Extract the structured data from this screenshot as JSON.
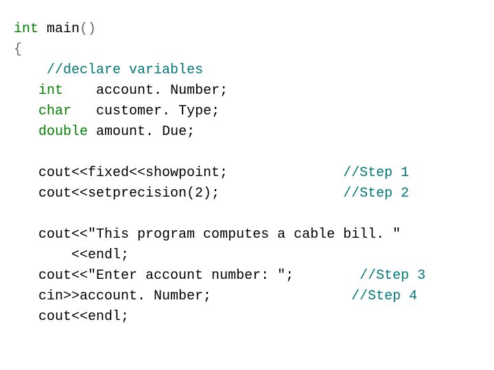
{
  "code": {
    "kw_int1": "int",
    "main": " main",
    "paren": "()",
    "brace_open": "{",
    "indent1": "    ",
    "cm_declare": "//declare variables",
    "indent2": "   ",
    "kw_int2": "int",
    "spc_int2": "    ",
    "var_account": "account. Number;",
    "kw_char": "char",
    "spc_char": "   ",
    "var_cust": "customer. Type;",
    "kw_double": "double",
    "spc_double": " ",
    "var_amount": "amount. Due;",
    "blank": "",
    "cout1a": "cout<<fixed<<showpoint;",
    "gap1": "              ",
    "cm_step1": "//Step 1",
    "cout2a": "cout<<setprecision(2);",
    "gap2": "               ",
    "cm_step2": "//Step 2",
    "cout3a": "cout<<",
    "str3": "\"This program computes a cable bill. \"",
    "cout3b": "       <<endl;",
    "cout4a": "cout<<",
    "str4": "\"Enter account number: \"",
    "cout4b": ";",
    "gap4": "        ",
    "cm_step3": "//Step 3",
    "cin5": "cin>>account. Number;",
    "gap5": "                 ",
    "cm_step4": "//Step 4",
    "cout6": "cout<<endl;"
  }
}
